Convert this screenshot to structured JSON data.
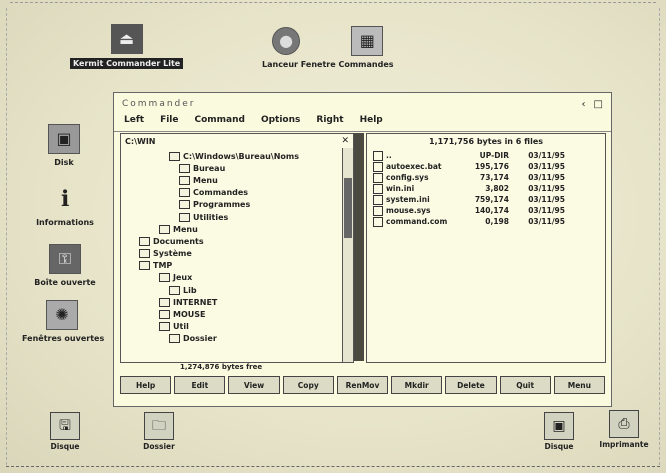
{
  "desktop": {
    "top_icons": [
      {
        "label": "Kermit Commander Lite",
        "icon": "drive-icon"
      },
      {
        "label": "Lanceur Fenetre Commandes",
        "icon": "disc-icon"
      }
    ],
    "side_icons": [
      {
        "label": "Disk",
        "icon": "disk-icon"
      },
      {
        "label": "Informations",
        "icon": "info-icon"
      },
      {
        "label": "Boîte ouverte",
        "icon": "box-icon"
      },
      {
        "label": "Fenêtres ouvertes",
        "icon": "window-icon"
      }
    ],
    "bottom_icons": [
      {
        "label": "Disque",
        "icon": "floppy-icon"
      },
      {
        "label": "Dossier",
        "icon": "folder-icon"
      },
      {
        "label": "Disque",
        "icon": "save-icon"
      },
      {
        "label": "Imprimante",
        "icon": "printer-icon"
      }
    ]
  },
  "window": {
    "title": "Commander",
    "controls": [
      "‹",
      "□"
    ],
    "menu": [
      "Left",
      "File",
      "Command",
      "Options",
      "Right",
      "Help"
    ],
    "left_pane": {
      "path": "C:\\WIN",
      "tree": [
        "C:\\Windows\\Bureau\\Noms",
        "Bureau",
        "Menu",
        "Commandes",
        "Programmes",
        "Utilities",
        "Menu",
        "Documents",
        "Système",
        "TMP",
        "Jeux",
        "Lib",
        "INTERNET",
        "MOUSE",
        "Util",
        "Dossier"
      ],
      "status": "1,274,876 bytes free"
    },
    "right_pane": {
      "header": "1,171,756 bytes in 6 files",
      "files": [
        {
          "name": "..",
          "size": "UP-DIR",
          "date": "03/11/95"
        },
        {
          "name": "autoexec.bat",
          "size": "195,176",
          "date": "03/11/95"
        },
        {
          "name": "config.sys",
          "size": "73,174",
          "date": "03/11/95"
        },
        {
          "name": "win.ini",
          "size": "3,802",
          "date": "03/11/95"
        },
        {
          "name": "system.ini",
          "size": "759,174",
          "date": "03/11/95"
        },
        {
          "name": "mouse.sys",
          "size": "140,174",
          "date": "03/11/95"
        },
        {
          "name": "command.com",
          "size": "0,198",
          "date": "03/11/95"
        }
      ]
    },
    "fkeys": [
      "Help",
      "Edit",
      "View",
      "Copy",
      "RenMov",
      "Mkdir",
      "Delete",
      "Quit",
      "Menu"
    ]
  }
}
